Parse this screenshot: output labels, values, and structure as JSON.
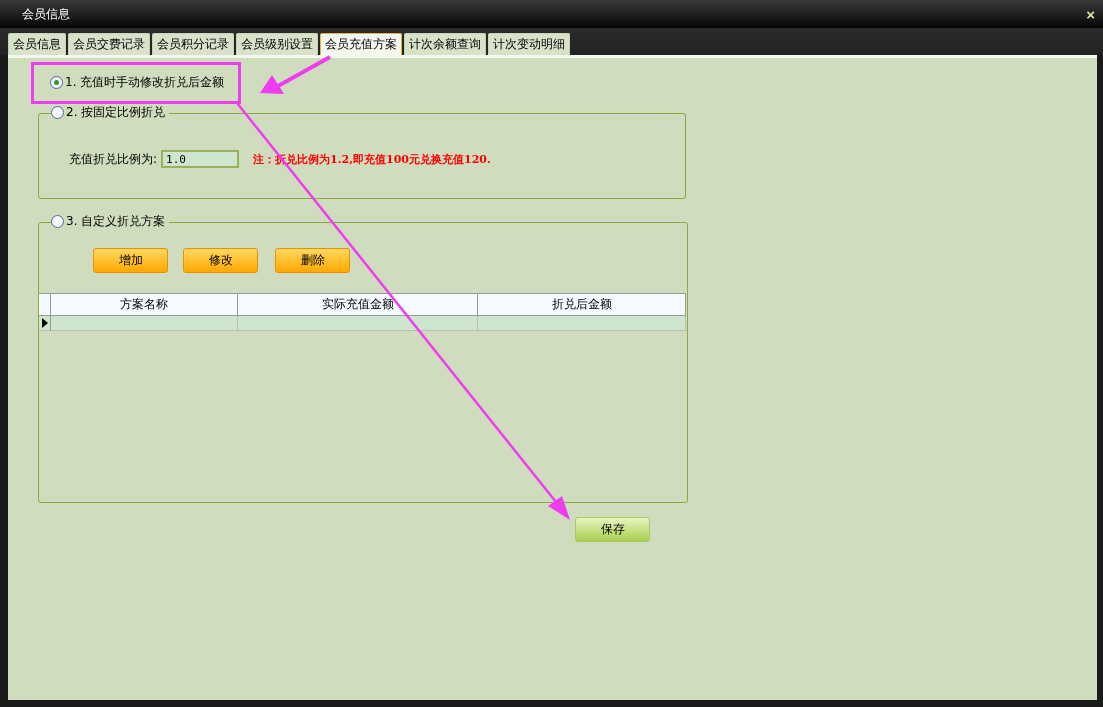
{
  "window": {
    "title": "会员信息",
    "close": "×"
  },
  "tabs": [
    {
      "label": "会员信息",
      "selected": false
    },
    {
      "label": "会员交费记录",
      "selected": false
    },
    {
      "label": "会员积分记录",
      "selected": false
    },
    {
      "label": "会员级别设置",
      "selected": false
    },
    {
      "label": "会员充值方案",
      "selected": true
    },
    {
      "label": "计次余额查询",
      "selected": false
    },
    {
      "label": "计次变动明细",
      "selected": false
    }
  ],
  "options": [
    {
      "kind": "plain",
      "label": "1. 充值时手动修改折兑后金额",
      "selected": true
    },
    {
      "kind": "ratio",
      "label": "2. 按固定比例折兑",
      "selected": false,
      "field_label": "充值折兑比例为:",
      "field_value": "1.0",
      "note": "注：折兑比例为1.2,即充值100元兑换充值120."
    },
    {
      "kind": "custom",
      "label": "3. 自定义折兑方案",
      "selected": false,
      "buttons": [
        "增加",
        "修改",
        "删除"
      ],
      "table": {
        "columns": [
          "方案名称",
          "实际充值金额",
          "折兑后金额"
        ]
      }
    }
  ],
  "save_button": "保存"
}
